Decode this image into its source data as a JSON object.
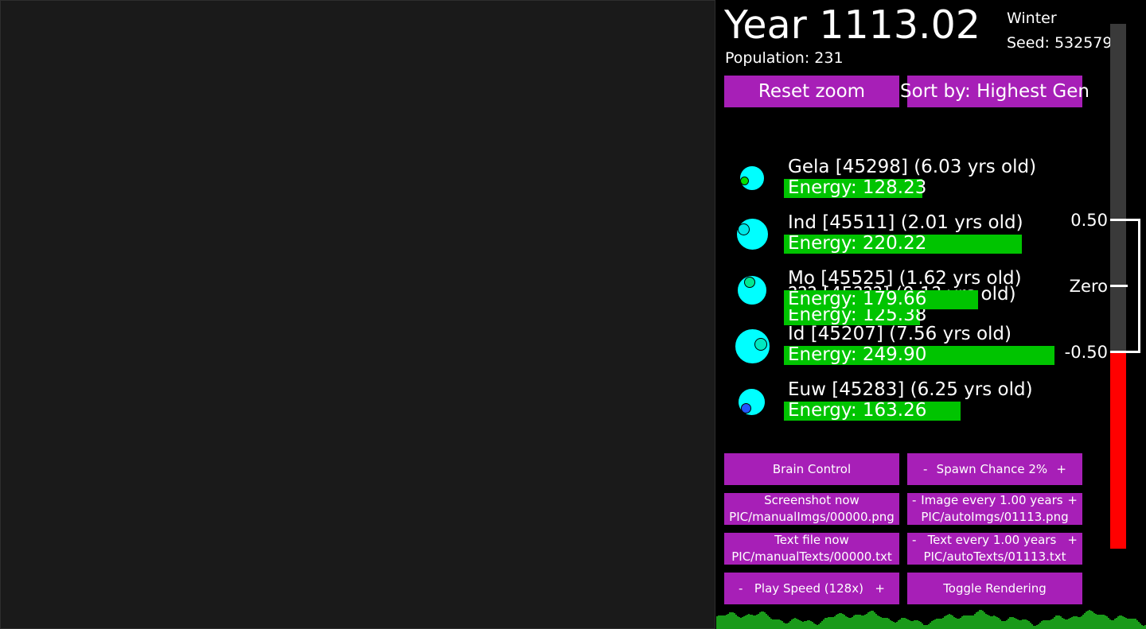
{
  "title": "Year 1113.02",
  "season": "Winter",
  "seed": "Seed: 532579",
  "population": "Population: 231",
  "top_buttons": {
    "reset_zoom": "Reset zoom",
    "sort_by": "Sort by: Highest Gen"
  },
  "creatures": [
    {
      "name": "Gela [45298] (6.03 yrs old)",
      "energy": "Energy: 128.23",
      "energy_value": 128.23,
      "mouth_color": "#00e000"
    },
    {
      "name": "Ind [45511] (2.01 yrs old)",
      "energy": "Energy: 220.22",
      "energy_value": 220.22,
      "mouth_color": "#00e8e8"
    },
    {
      "name": "??? [45???] (0.1? yrs old)",
      "energy": "Energy: 125.38",
      "energy_value": 125.38,
      "mouth_color": "#00e000"
    },
    {
      "name": "Mo [45525] (1.62 yrs old)",
      "energy": "Energy: 179.66",
      "energy_value": 179.66,
      "mouth_color": "#00e890"
    },
    {
      "name": "Id [45207] (7.56 yrs old)",
      "energy": "Energy: 249.90",
      "energy_value": 249.9,
      "mouth_color": "#00e8c0"
    },
    {
      "name": "Euw [45283] (6.25 yrs old)",
      "energy": "Energy: 163.26",
      "energy_value": 163.26,
      "mouth_color": "#2255ff"
    }
  ],
  "controls": {
    "brain_control": "Brain Control",
    "spawn_minus": "-",
    "spawn_label": "Spawn Chance 2%",
    "spawn_plus": "+",
    "screenshot_label": "Screenshot now",
    "screenshot_path": "PIC/manualImgs/00000.png",
    "image_minus": "-",
    "image_label": "Image every 1.00 years",
    "image_plus": "+",
    "image_path": "PIC/autoImgs/01113.png",
    "textfile_label": "Text file now",
    "textfile_path": "PIC/manualTexts/00000.txt",
    "text_minus": "-",
    "text_label": "Text every 1.00 years",
    "text_plus": "+",
    "text_path": "PIC/autoTexts/01113.txt",
    "speed_minus": "-",
    "speed_label": "Play Speed (128x)",
    "speed_plus": "+",
    "toggle_rendering": "Toggle Rendering"
  },
  "thermometer": {
    "label_high": "0.50",
    "label_zero": "Zero",
    "label_low": "-0.50",
    "track_color": "#3a3a3a",
    "fill_color": "#ff0000"
  },
  "colors": {
    "button": "#a71fb7",
    "creature_body": "#00ffff",
    "energy_bar": "#00c400",
    "population_graph": "#1a9a1a"
  }
}
